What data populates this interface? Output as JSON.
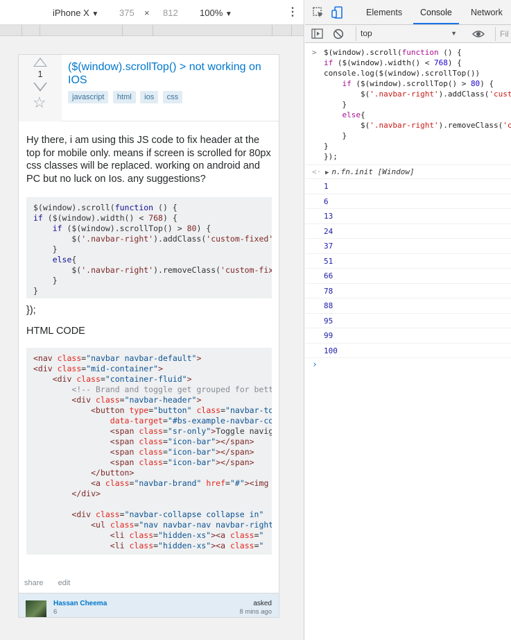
{
  "device_toolbar": {
    "device": "iPhone X",
    "width": "375",
    "times": "×",
    "height": "812",
    "zoom": "100%"
  },
  "question": {
    "votes": "1",
    "title": "($(window).scrollTop() > not working on IOS",
    "tags": [
      "javascript",
      "html",
      "ios",
      "css"
    ],
    "body": "Hy there, i am using this JS code to fix header at the top for mobile only. means if screen is scrolled for 80px css classes will be replaced. working on android and PC but no luck on Ios. any suggestions?",
    "closing": "});",
    "html_heading": "HTML CODE",
    "post_menu": [
      "share",
      "edit"
    ],
    "owner": {
      "name": "Hassan Cheema",
      "reputation": "6",
      "asked_label": "asked",
      "asked_time": "8 mins ago"
    }
  },
  "devtools": {
    "tabs": [
      "Elements",
      "Console",
      "Network"
    ],
    "active_tab": "Console",
    "context": "top",
    "filter_placeholder": "Fil",
    "result_text": "n.fn.init [Window]",
    "logs": [
      "1",
      "6",
      "13",
      "24",
      "37",
      "51",
      "66",
      "78",
      "88",
      "95",
      "99",
      "100"
    ],
    "prompt_symbol": "›"
  },
  "colors": {
    "link": "#0077cc",
    "tag_bg": "#e1ecf4",
    "tag_text": "#39739d",
    "code_bg": "#eff0f1",
    "active_tab_underline": "#1a73e8",
    "log_number": "#1a1aa6"
  },
  "icons": [
    "chevron-down-icon",
    "more-vert-icon",
    "upvote-icon",
    "downvote-icon",
    "star-icon",
    "inspect-icon",
    "device-toggle-icon",
    "sidebar-icon",
    "clear-console-icon",
    "eye-icon",
    "expand-triangle-icon"
  ]
}
